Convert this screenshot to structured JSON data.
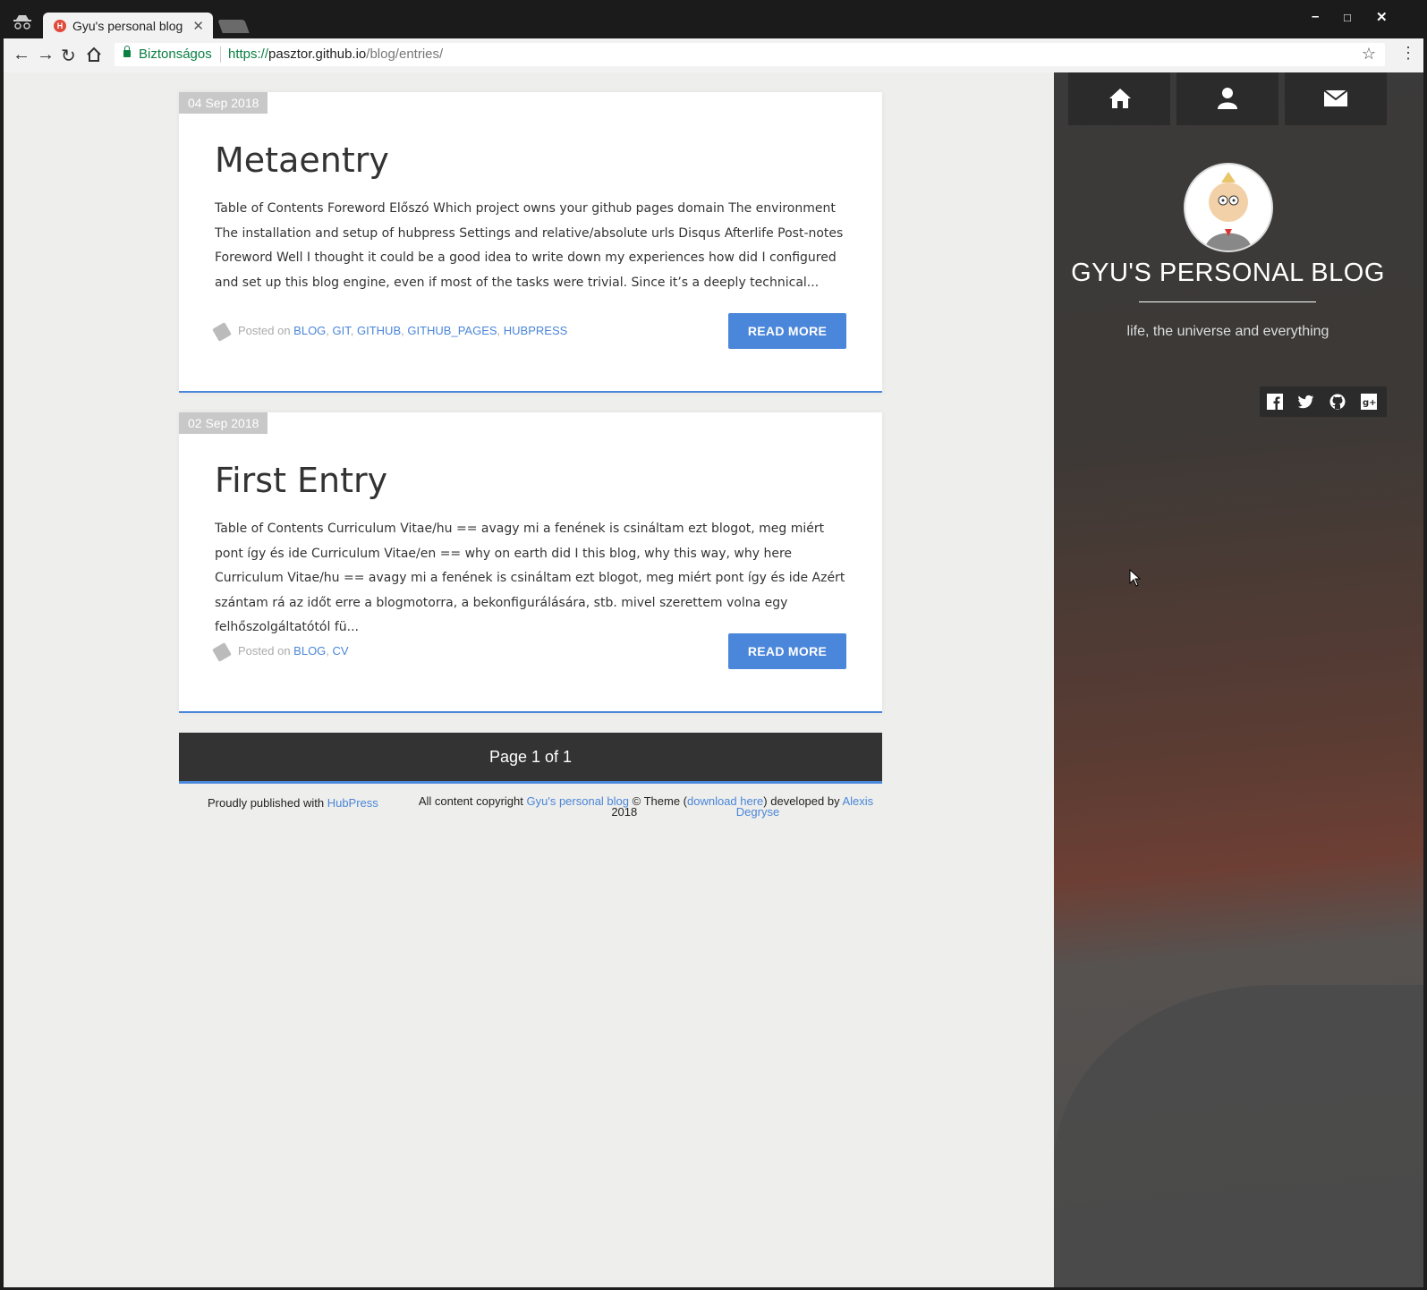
{
  "browser": {
    "tab_title": "Gyu's personal blog",
    "secure_label": "Biztonságos",
    "url_scheme": "https://",
    "url_host": "pasztor.github.io",
    "url_path": "/blog/entries/"
  },
  "posts": [
    {
      "date": "04 Sep 2018",
      "title": "Metaentry",
      "excerpt": "Table of Contents Foreword Előszó Which project owns your github pages domain The environment The installation and setup of hubpress Settings and relative/absolute urls Disqus Afterlife Post-notes Foreword Well I thought it could be a good idea to write down my experiences how did I configured and set up this blog engine, even if most of the tasks were trivial. Since it’s a deeply technical...",
      "posted_on": "Posted on",
      "tags": [
        "BLOG",
        "GIT",
        "GITHUB",
        "GITHUB_PAGES",
        "HUBPRESS"
      ],
      "read_more": "READ MORE"
    },
    {
      "date": "02 Sep 2018",
      "title": "First Entry",
      "excerpt": "Table of Contents Curriculum Vitae/hu == avagy mi a fenének is csináltam ezt blogot, meg miért pont így és ide Curriculum Vitae/en == why on earth did I this blog, why this way, why here Curriculum Vitae/hu == avagy mi a fenének is csináltam ezt blogot, meg miért pont így és ide Azért szántam rá az időt erre a blogmotorra, a bekonfigurálására, stb. mivel szerettem volna egy felhőszolgáltatótól fü...",
      "posted_on": "Posted on",
      "tags": [
        "BLOG",
        "CV"
      ],
      "read_more": "READ MORE"
    }
  ],
  "pagination": {
    "label": "Page 1 of 1"
  },
  "footer": {
    "published_prefix": "Proudly published with",
    "published_link": "HubPress",
    "copyright_prefix": "All content copyright",
    "copyright_link": "Gyu's personal blog",
    "copyright_mid": "© Theme (",
    "theme_link": "download here",
    "developed_by": ") developed by",
    "author_first": "Alexis",
    "year": "2018",
    "author_last": "Degryse"
  },
  "sidebar": {
    "nav_icons": [
      "home-icon",
      "user-icon",
      "mail-icon"
    ],
    "blog_title": "GYU'S PERSONAL BLOG",
    "tagline": "life, the universe and everything",
    "social_icons": [
      "facebook-icon",
      "twitter-icon",
      "github-icon",
      "google-plus-icon"
    ]
  },
  "colors": {
    "accent": "#4a86d9",
    "dark": "#333333"
  }
}
